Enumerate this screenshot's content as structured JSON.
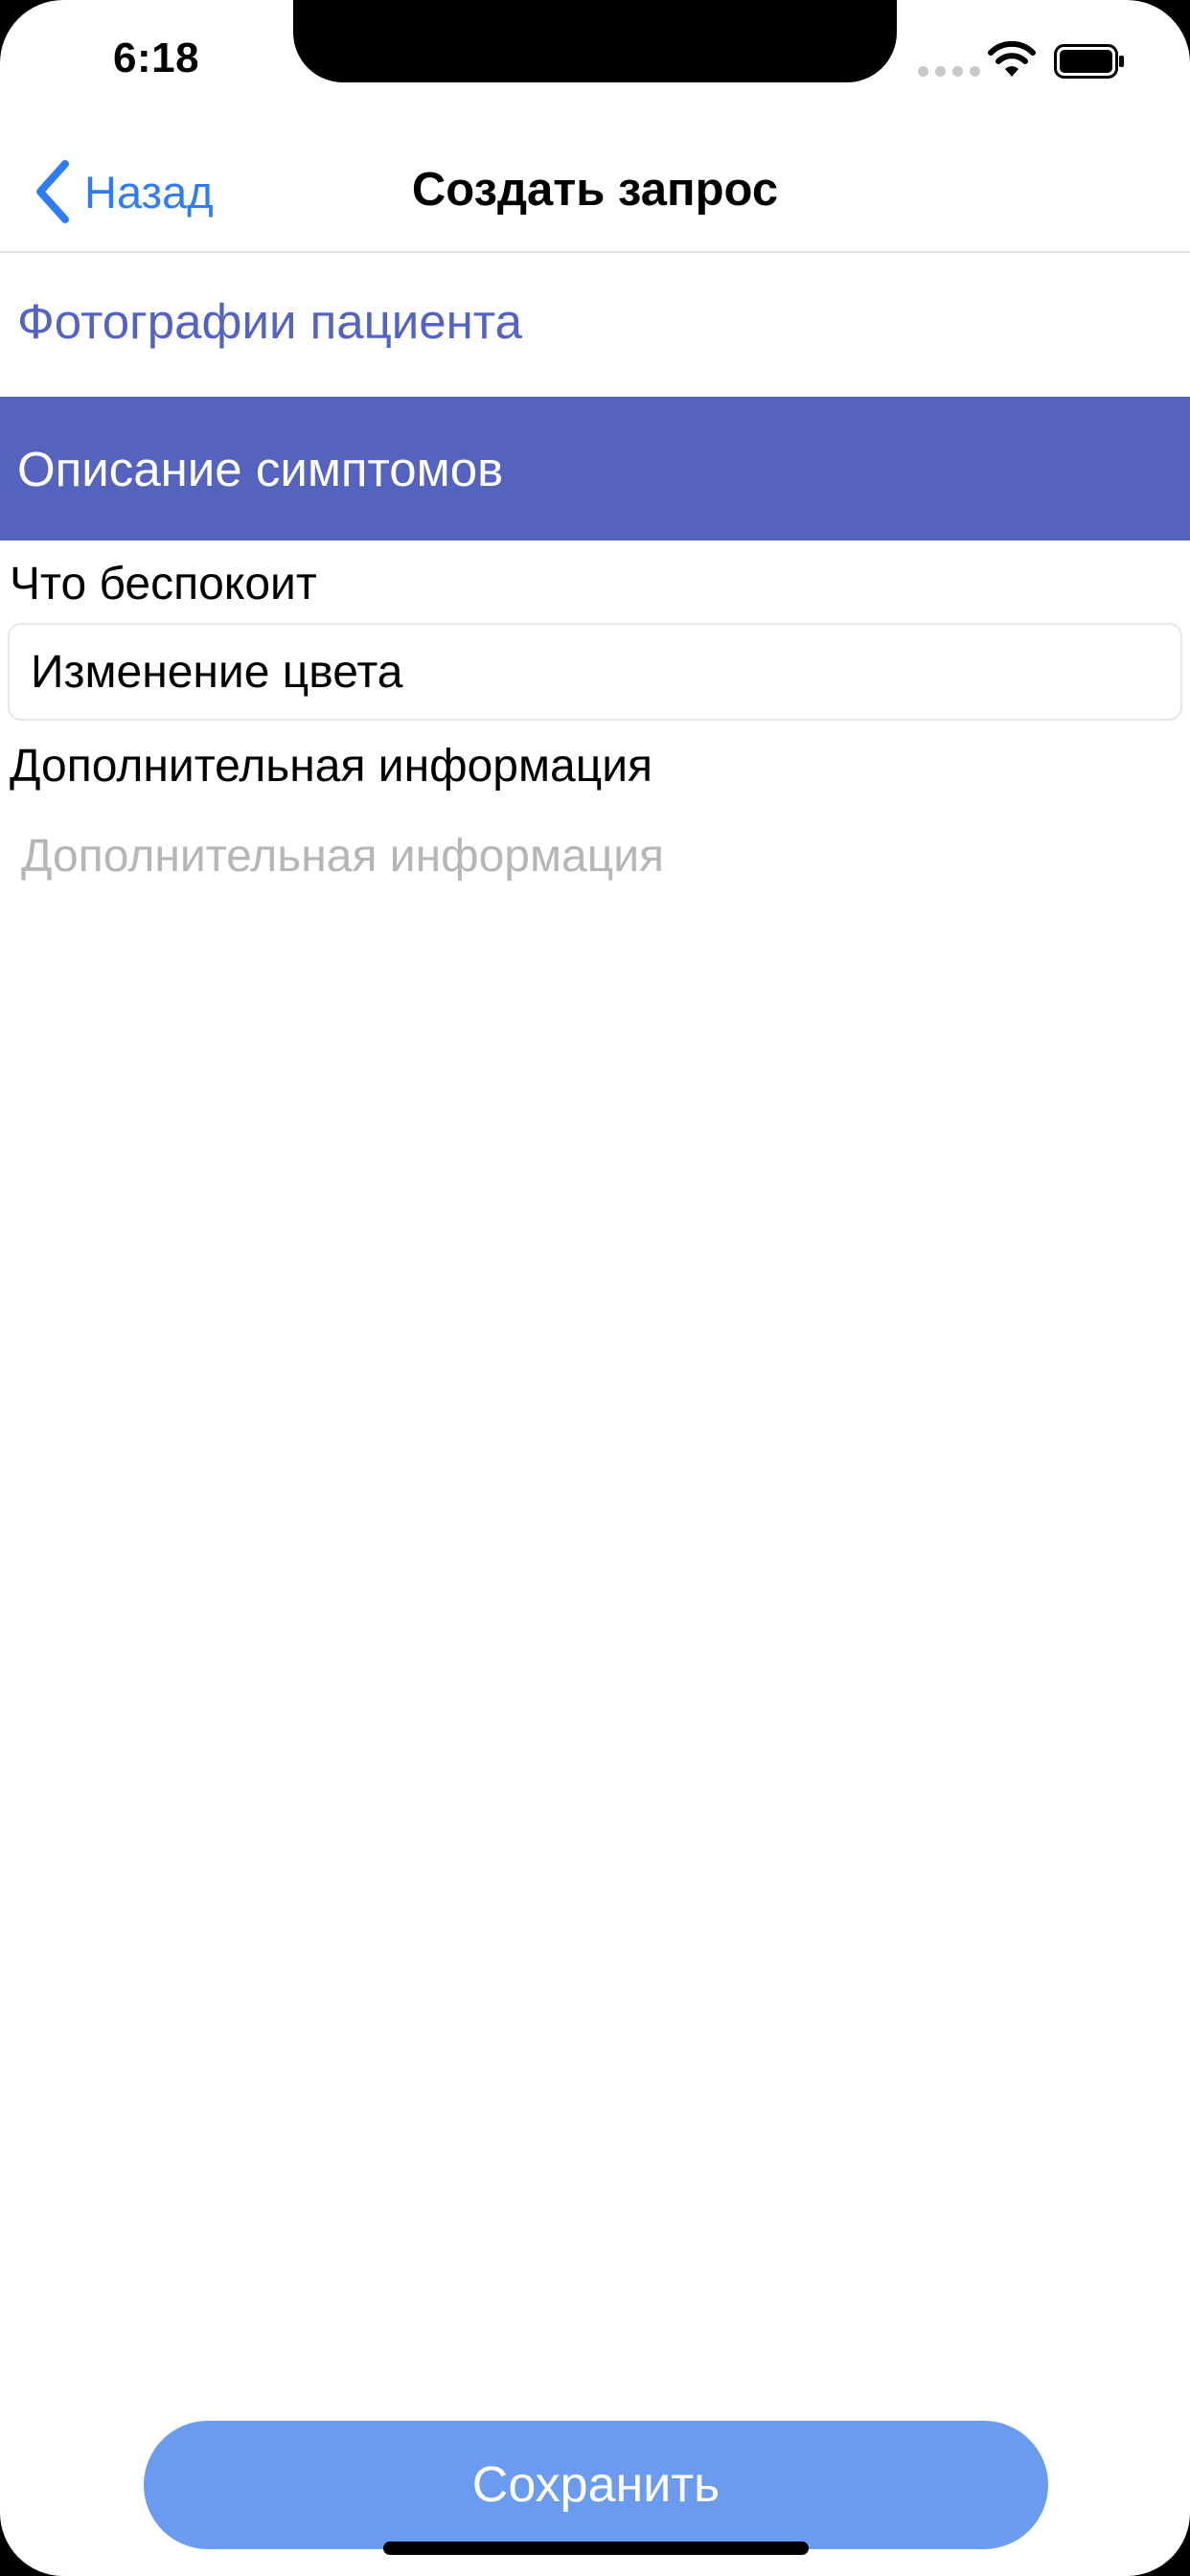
{
  "status_bar": {
    "time": "6:18",
    "icons": [
      "signal-dots-icon",
      "wifi-icon",
      "battery-icon"
    ]
  },
  "nav": {
    "back_label": "Назад",
    "back_icon": "chevron-left-icon",
    "title": "Создать запрос"
  },
  "sections": {
    "photos": "Фотографии пациента",
    "symptoms": "Описание симптомов"
  },
  "form": {
    "concern_label": "Что беспокоит",
    "concern_value": "Изменение цвета",
    "info_label": "Дополнительная информация",
    "info_placeholder": "Дополнительная информация"
  },
  "actions": {
    "save_label": "Сохранить"
  },
  "colors": {
    "accent_blue": "#2f7df6",
    "section_text": "#5363c4",
    "section_active_bg": "#5463bd",
    "save_button_bg": "#6a9bef",
    "placeholder": "#b5b5ba"
  }
}
